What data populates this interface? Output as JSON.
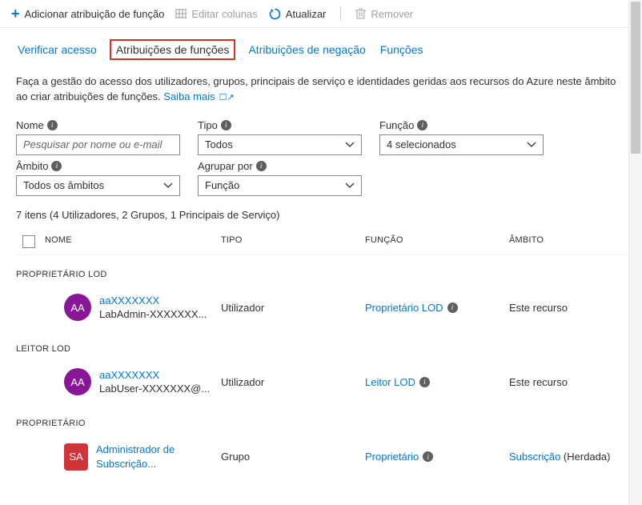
{
  "toolbar": {
    "add_label": "Adicionar atribuição de função",
    "edit_columns_label": "Editar colunas",
    "refresh_label": "Atualizar",
    "remove_label": "Remover"
  },
  "tabs": {
    "check_access": "Verificar acesso",
    "role_assignments": "Atribuições de funções",
    "deny_assignments": "Atribuições de negação",
    "roles": "Funções"
  },
  "description": {
    "text": "Faça a gestão do acesso dos utilizadores, grupos, principais de serviço e identidades geridas aos recursos do Azure neste âmbito ao criar atribuições de funções.",
    "learn_more": "Saiba mais"
  },
  "filters": {
    "name_label": "Nome",
    "name_placeholder": "Pesquisar por nome ou e-mail",
    "type_label": "Tipo",
    "type_value": "Todos",
    "role_label": "Função",
    "role_value": "4 selecionados",
    "scope_label": "Âmbito",
    "scope_value": "Todos os âmbitos",
    "group_by_label": "Agrupar por",
    "group_by_value": "Função"
  },
  "count_line": "7 itens (4 Utilizadores, 2 Grupos, 1 Principais de Serviço)",
  "columns": {
    "name": "NOME",
    "type": "TIPO",
    "role": "FUNÇÃO",
    "scope": "ÂMBITO"
  },
  "groups": [
    {
      "header": "PROPRIETÁRIO LOD",
      "rows": [
        {
          "avatar_text": "AA",
          "avatar_color": "purple",
          "name": "aaXXXXXXX",
          "sub": "LabAdmin-XXXXXXX...",
          "type": "Utilizador",
          "role": "Proprietário LOD",
          "scope_text": "Este recurso",
          "scope_link": false
        }
      ]
    },
    {
      "header": "LEITOR LOD",
      "rows": [
        {
          "avatar_text": "AA",
          "avatar_color": "purple",
          "name": "aaXXXXXXX",
          "sub": "LabUser-XXXXXXX@...",
          "type": "Utilizador",
          "role": "Leitor LOD",
          "scope_text": "Este recurso",
          "scope_link": false
        }
      ]
    },
    {
      "header": "PROPRIETÁRIO",
      "rows": [
        {
          "avatar_text": "SA",
          "avatar_color": "red",
          "name": "Administrador de Subscrição...",
          "sub": "",
          "type": "Grupo",
          "role": "Proprietário",
          "scope_text": "Subscrição",
          "scope_link": true,
          "scope_suffix": " (Herdada)"
        }
      ]
    }
  ]
}
